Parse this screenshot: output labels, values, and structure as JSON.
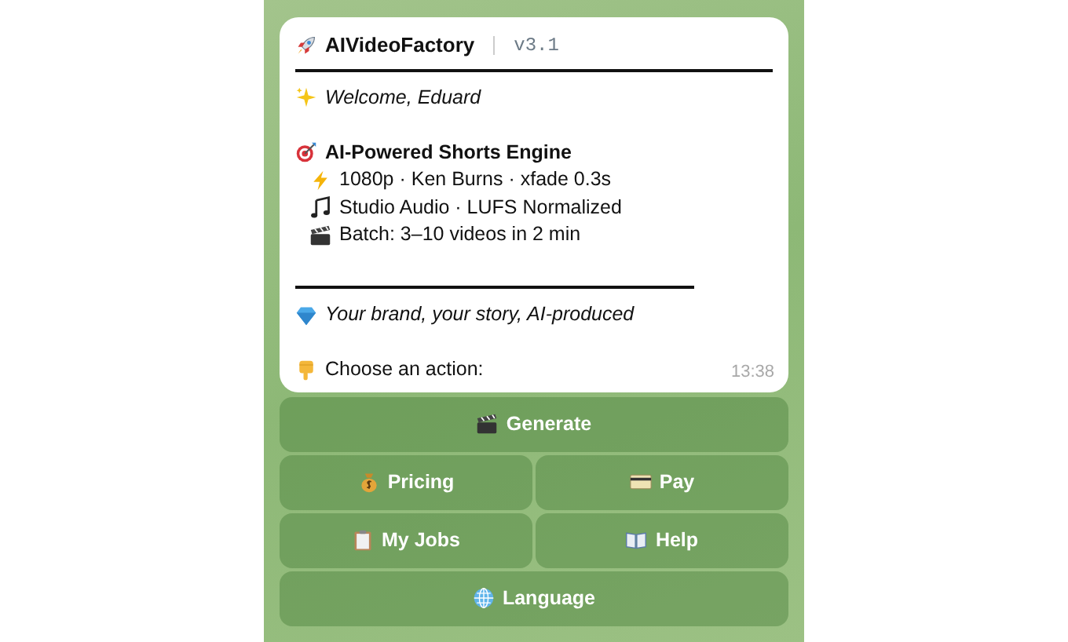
{
  "message": {
    "title": "AIVideoFactory",
    "version": "v3.1",
    "greeting": "Welcome, Eduard",
    "heading": "AI-Powered Shorts Engine",
    "features": [
      "1080p · Ken Burns · xfade 0.3s",
      "Studio Audio · LUFS Normalized",
      "Batch: 3–10 videos in 2 min"
    ],
    "tagline": "Your brand, your story, AI-produced",
    "prompt": "Choose an action:",
    "time": "13:38"
  },
  "keyboard": [
    {
      "buttons": [
        {
          "label": "Generate"
        }
      ]
    },
    {
      "buttons": [
        {
          "label": "Pricing"
        },
        {
          "label": "Pay"
        }
      ]
    },
    {
      "buttons": [
        {
          "label": "My Jobs"
        },
        {
          "label": "Help"
        }
      ]
    },
    {
      "buttons": [
        {
          "label": "Language"
        }
      ]
    }
  ]
}
